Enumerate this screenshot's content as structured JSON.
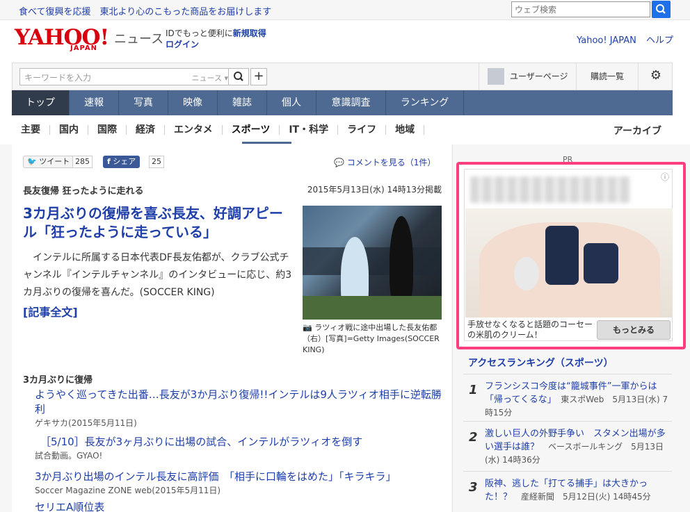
{
  "topbar": {
    "promo": "食べて復興を応援　東北より心のこもった商品をお届けします",
    "search_placeholder": "ウェブ検索"
  },
  "header": {
    "logo_main": "YAHOO!",
    "logo_sub": "JAPAN",
    "section": "ニュース",
    "id_text": "IDでもっと便利に",
    "register": "新規取得",
    "login": "ログイン",
    "links": [
      "Yahoo! JAPAN",
      "ヘルプ"
    ]
  },
  "search": {
    "placeholder": "キーワードを入力",
    "scope": "ニュース ▾",
    "user_page": "ユーザーページ",
    "subscribe": "購読一覧"
  },
  "nav": {
    "tabs": [
      {
        "label": "トップ",
        "width": 83
      },
      {
        "label": "速報",
        "width": 71
      },
      {
        "label": "写真",
        "width": 71
      },
      {
        "label": "映像",
        "width": 71
      },
      {
        "label": "雑誌",
        "width": 71
      },
      {
        "label": "個人",
        "width": 71
      },
      {
        "label": "意識調査",
        "width": 100
      },
      {
        "label": "ランキング",
        "width": 112
      }
    ],
    "sub": [
      "主要",
      "国内",
      "国際",
      "経済",
      "エンタメ",
      "スポーツ",
      "IT・科学",
      "ライフ",
      "地域"
    ],
    "archive": "アーカイブ"
  },
  "share": {
    "tweet": "ツイート",
    "tweet_count": "285",
    "fb": "シェア",
    "fb_count": "25",
    "comments": "コメントを見る（1件）"
  },
  "article": {
    "section_title": "長友復帰 狂ったように走れる",
    "date": "2015年5月13日(水) 14時13分掲載",
    "headline": "3カ月ぶりの復帰を喜ぶ長友、好調アピール「狂ったように走っている」",
    "lead": "インテルに所属する日本代表DF長友佑都が、クラブ公式チャンネル『インテルチャンネル』のインタビューに応じ、約3カ月ぶりの復帰を喜んだ。(SOCCER KING)",
    "full_article": "[記事全文]",
    "photo_caption": "ラツィオ戦に途中出場した長友佑都（右）[写真]=Getty Images(SOCCER KING)"
  },
  "related": {
    "title": "3カ月ぶりに復帰",
    "items": [
      {
        "link": "ようやく巡ってきた出番…長友が3か月ぶり復帰!!インテルは9人ラツィオ相手に逆転勝利",
        "source": "ゲキサカ(2015年5月11日)"
      },
      {
        "link": "［5/10］長友が3ヶ月ぶりに出場の試合、インテルがラツィオを倒す",
        "source": "試合動画。GYAO!"
      },
      {
        "link": "3か月ぶり出場のインテル長友に高評価　「相手に口輪をはめた」「キラキラ」",
        "source": "Soccer Magazine ZONE web(2015年5月11日)"
      },
      {
        "link": "セリエA順位表",
        "source": ""
      }
    ]
  },
  "sidebar": {
    "pr": "PR",
    "ad_text": "手放せなくなると話題のコーセーの米肌のクリーム！",
    "ad_more": "もっとみる",
    "ranking_title": "アクセスランキング（スポーツ）",
    "ranking": [
      {
        "num": "1",
        "title": "フランシスコ今度は“籠城事件”一軍からは「帰ってくるな」",
        "meta": "東スポWeb　5月13日(水) 7時15分"
      },
      {
        "num": "2",
        "title": "激しい巨人の外野手争い　スタメン出場が多い選手は誰？",
        "meta": "ベースボールキング　5月13日(水) 14時36分"
      },
      {
        "num": "3",
        "title": "阪神、逃した「打てる捕手」は大きかった！？",
        "meta": "産経新聞　5月12日(火) 14時45分"
      }
    ]
  }
}
